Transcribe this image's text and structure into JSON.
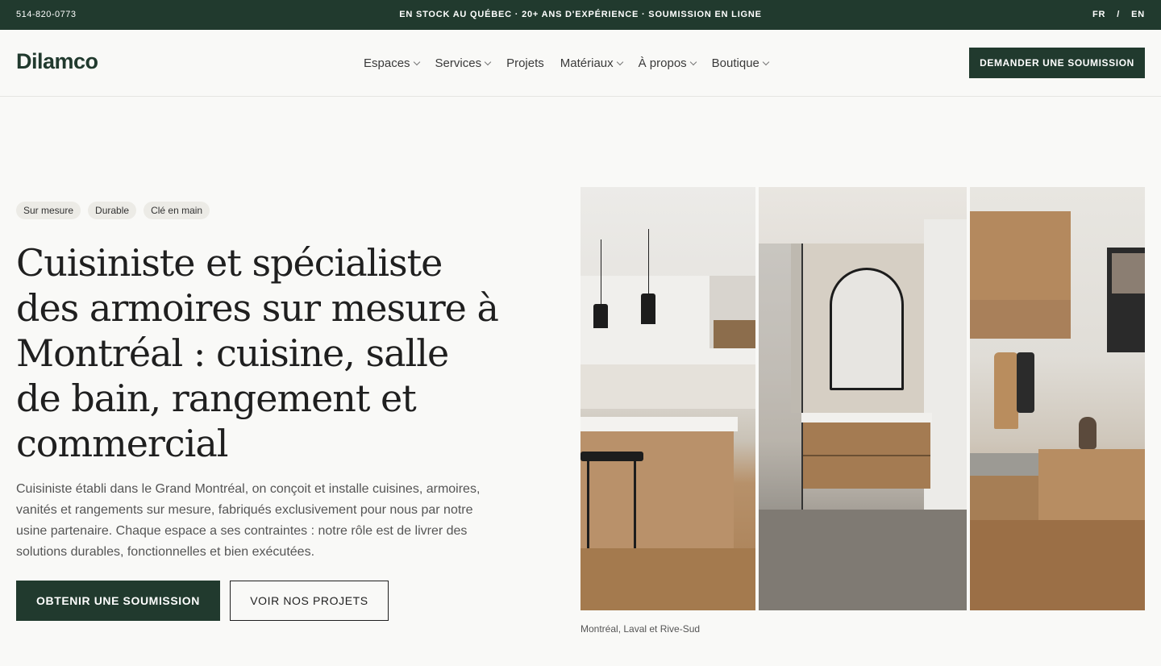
{
  "topbar": {
    "phone": "514-820-0773",
    "tagline": "EN STOCK AU QUÉBEC · 20+ ANS D'EXPÉRIENCE · SOUMISSION EN LIGNE",
    "lang_fr": "FR",
    "lang_sep": "/",
    "lang_en": "EN"
  },
  "header": {
    "logo": "Dilamco",
    "nav": [
      {
        "label": "Espaces",
        "has_dropdown": true
      },
      {
        "label": "Services",
        "has_dropdown": true
      },
      {
        "label": "Projets",
        "has_dropdown": false
      },
      {
        "label": "Matériaux",
        "has_dropdown": true
      },
      {
        "label": "À propos",
        "has_dropdown": true
      },
      {
        "label": "Boutique",
        "has_dropdown": true
      }
    ],
    "cta": "DEMANDER UNE SOUMISSION"
  },
  "hero": {
    "badges": [
      "Sur mesure",
      "Durable",
      "Clé en main"
    ],
    "title": "Cuisiniste et spécialiste des armoires sur mesure à Montréal : cuisine, salle de bain, rangement et commercial",
    "text": "Cuisiniste établi dans le Grand Montréal, on conçoit et installe cuisines, armoires, vanités et rangements sur mesure, fabriqués exclusivement pour nous par notre usine partenaire. Chaque espace a ses contraintes : notre rôle est de livrer des solutions durables, fonctionnelles et bien exécutées.",
    "primary_button": "OBTENIR UNE SOUMISSION",
    "secondary_button": "VOIR NOS PROJETS",
    "caption": "Montréal, Laval et Rive-Sud"
  },
  "colors": {
    "brand": "#213a2e",
    "background": "#f9f9f7"
  }
}
